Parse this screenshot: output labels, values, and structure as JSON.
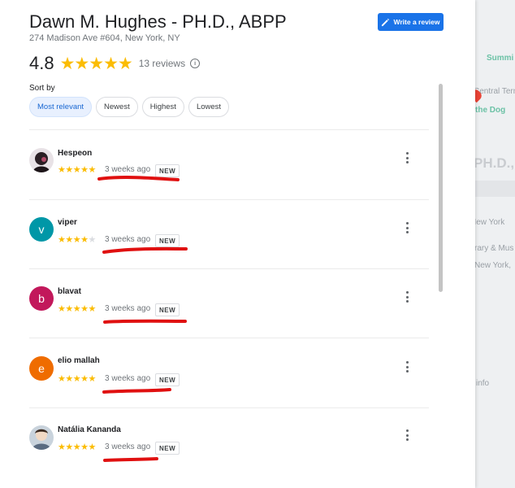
{
  "place": {
    "title": "Dawn M. Hughes - PH.D., ABPP",
    "address": "274 Madison Ave #604, New York, NY"
  },
  "actions": {
    "write_review": "Write a review"
  },
  "rating": {
    "value": "4.8",
    "stars_text": "★★★★★",
    "count_text": "13 reviews",
    "info_glyph": "i"
  },
  "sort": {
    "label": "Sort by",
    "options": [
      "Most relevant",
      "Newest",
      "Highest",
      "Lowest"
    ],
    "selected": "Most relevant"
  },
  "reviews": [
    {
      "name": "Hespeon",
      "stars": 5,
      "date": "3 weeks ago",
      "badge": "NEW",
      "avatar_letter": "",
      "avatar_color": "#3a2a2a"
    },
    {
      "name": "viper",
      "stars": 4,
      "date": "3 weeks ago",
      "badge": "NEW",
      "avatar_letter": "v",
      "avatar_color": "#0097a7"
    },
    {
      "name": "blavat",
      "stars": 5,
      "date": "3 weeks ago",
      "badge": "NEW",
      "avatar_letter": "b",
      "avatar_color": "#c2185b"
    },
    {
      "name": "elio mallah",
      "stars": 5,
      "date": "3 weeks ago",
      "badge": "NEW",
      "avatar_letter": "e",
      "avatar_color": "#ef6c00"
    },
    {
      "name": "Natália Kananda",
      "stars": 5,
      "date": "3 weeks ago",
      "badge": "NEW",
      "avatar_letter": "",
      "avatar_color": "#8a9aa8"
    }
  ],
  "map_labels": [
    "Summi",
    "Central Term",
    "the Dog",
    "PH.D.,",
    "New York",
    "rary & Mus",
    "New York,",
    "info"
  ],
  "colors": {
    "accent": "#1a73e8",
    "star": "#fbbc04",
    "annotation": "#e01010"
  }
}
